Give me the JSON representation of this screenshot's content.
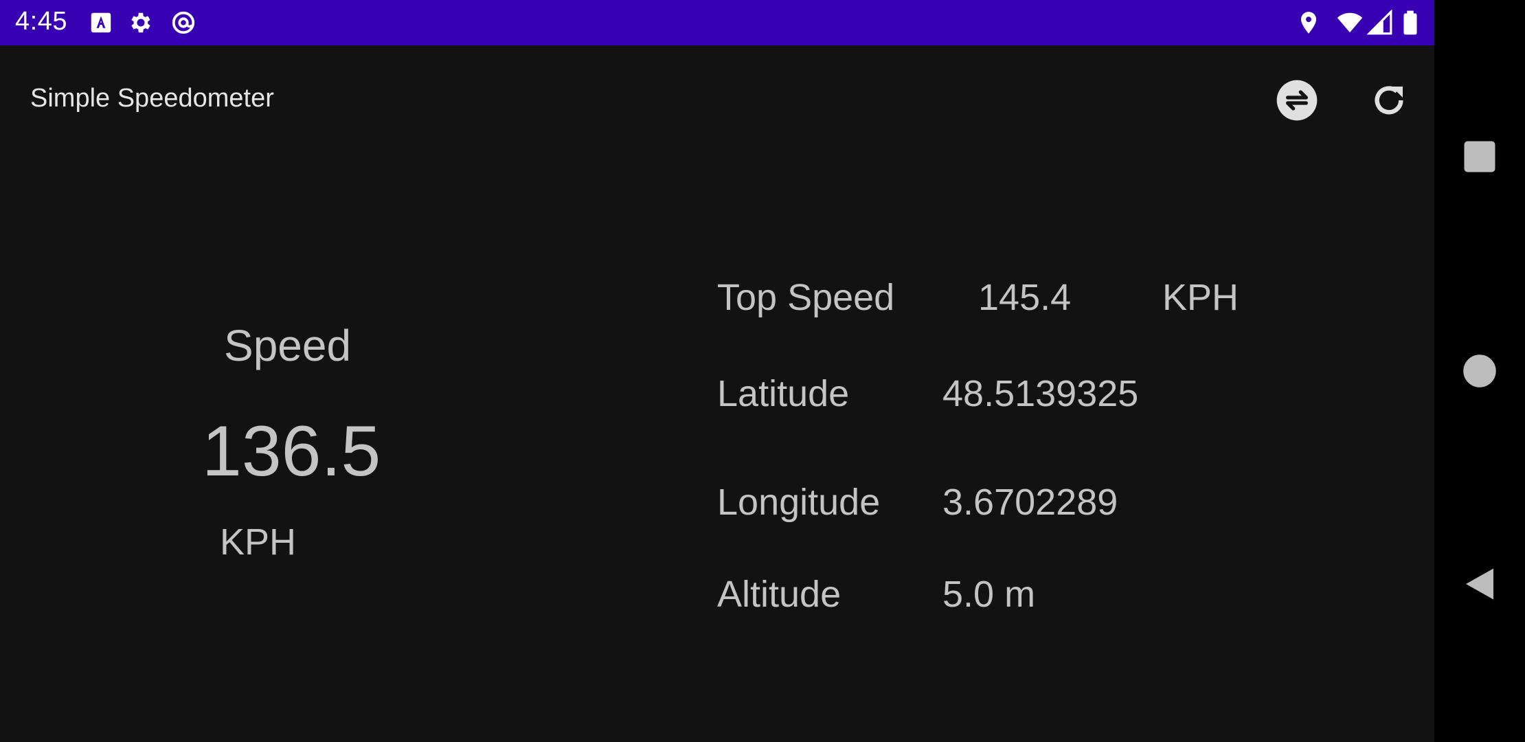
{
  "status_bar": {
    "time": "4:45",
    "background_color": "#3700b3",
    "left_icons": [
      "font-download-icon",
      "settings-gear-icon",
      "at-sign-icon"
    ],
    "right_icons": [
      "location-pin-icon",
      "wifi-icon",
      "cell-signal-icon",
      "battery-icon"
    ]
  },
  "app_bar": {
    "title": "Simple Speedometer",
    "actions": [
      "swap-units-icon",
      "refresh-icon"
    ]
  },
  "speed_panel": {
    "label": "Speed",
    "value": "136.5",
    "unit": "KPH"
  },
  "info_panel": {
    "top_speed": {
      "label": "Top Speed",
      "value": "145.4",
      "unit": "KPH"
    },
    "latitude": {
      "label": "Latitude",
      "value": "48.5139325"
    },
    "longitude": {
      "label": "Longitude",
      "value": "3.6702289"
    },
    "altitude": {
      "label": "Altitude",
      "value": "5.0 m"
    }
  },
  "nav_bar": {
    "buttons": [
      "recents-square-icon",
      "home-circle-icon",
      "back-triangle-icon"
    ]
  },
  "colors": {
    "background": "#121212",
    "text": "#c4c4c4",
    "nav_background": "#000000"
  }
}
